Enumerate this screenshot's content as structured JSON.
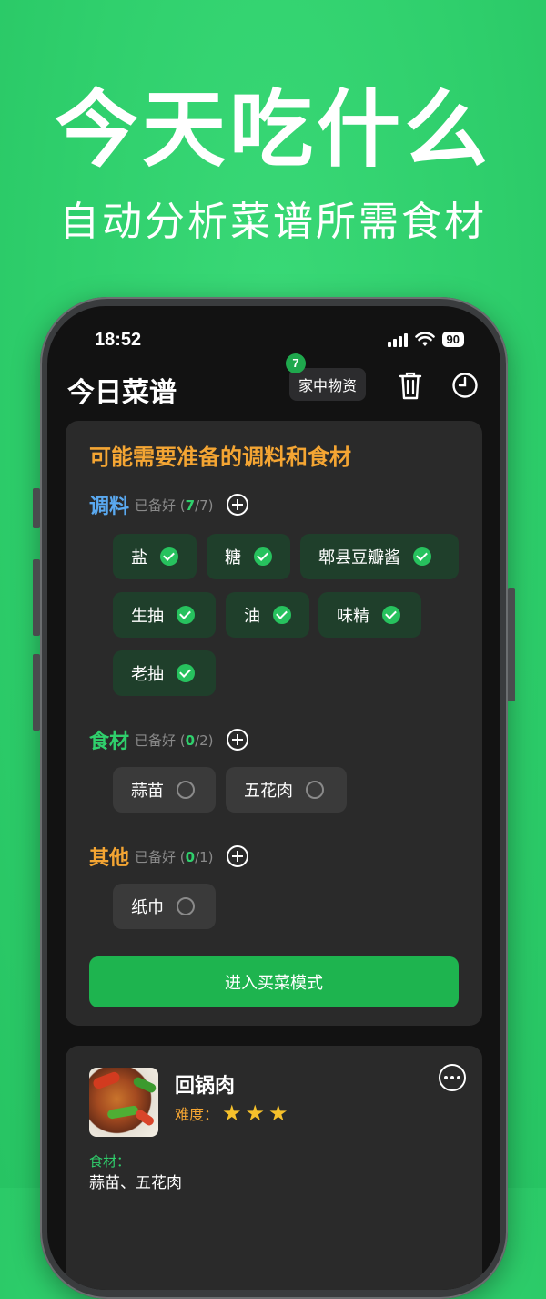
{
  "hero": {
    "title": "今天吃什么",
    "subtitle": "自动分析菜谱所需食材"
  },
  "status_bar": {
    "time": "18:52",
    "battery": "90"
  },
  "header": {
    "title": "今日菜谱",
    "home_button": "家中物资",
    "home_badge": "7",
    "icons": [
      "trash-icon",
      "clock-icon"
    ]
  },
  "prep_card": {
    "title": "可能需要准备的调料和食材",
    "sections": [
      {
        "name": "调料",
        "status_prefix": "已备好 (",
        "got": "7",
        "total": "/7)",
        "items": [
          "盐",
          "糖",
          "郫县豆瓣酱",
          "生抽",
          "油",
          "味精",
          "老抽"
        ]
      },
      {
        "name": "食材",
        "status_prefix": "已备好 (",
        "got": "0",
        "total": "/2)",
        "items": [
          "蒜苗",
          "五花肉"
        ]
      },
      {
        "name": "其他",
        "status_prefix": "已备好 (",
        "got": "0",
        "total": "/1)",
        "items": [
          "纸巾"
        ]
      }
    ],
    "buy_button": "进入买菜模式"
  },
  "dish_card": {
    "name": "回锅肉",
    "difficulty_label": "难度：",
    "difficulty_stars": 3,
    "ingredients_label": "食材：",
    "ingredients": "蒜苗、五花肉"
  },
  "colors": {
    "background_green": "#2fcf6c",
    "accent_orange": "#f4a533",
    "seasoning_blue": "#5aa9f0",
    "check_green": "#27c25e",
    "button_green": "#1eb44f"
  }
}
